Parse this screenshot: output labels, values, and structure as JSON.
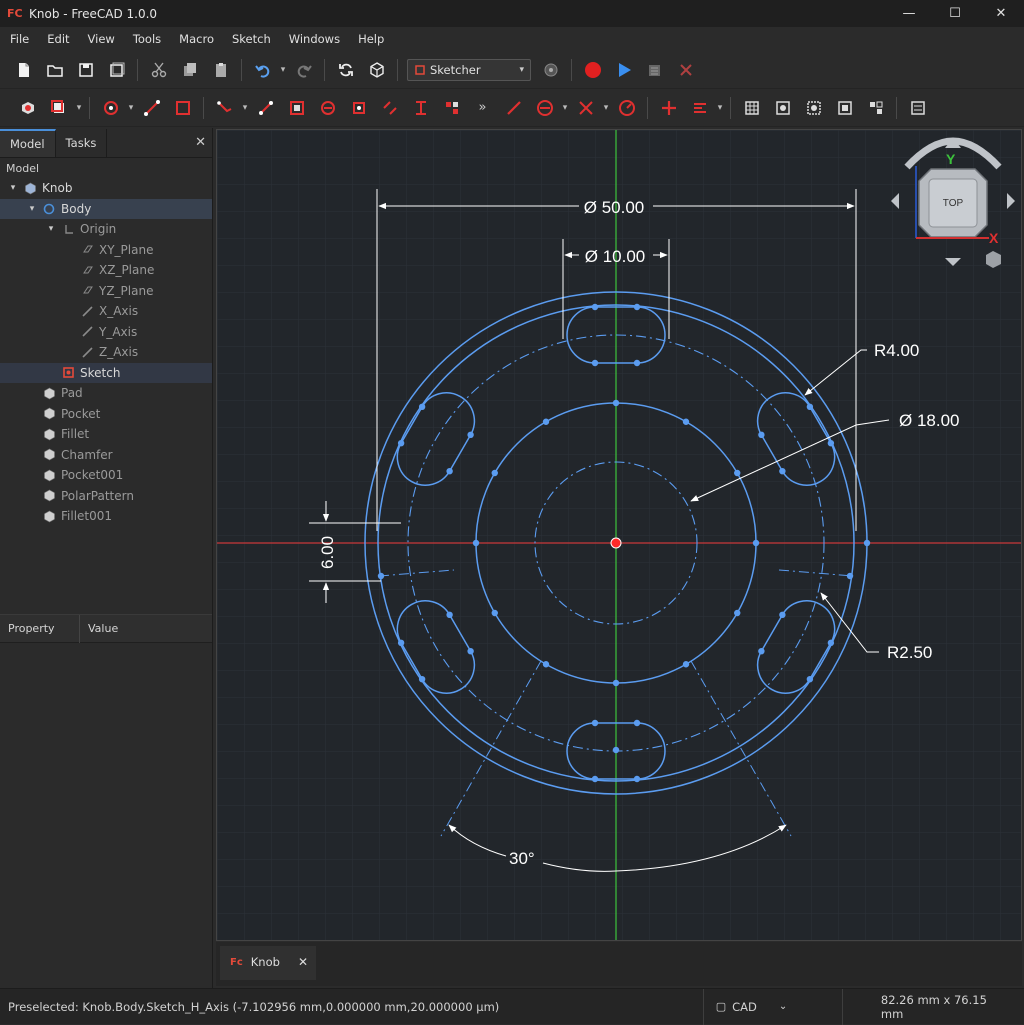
{
  "window": {
    "title": "Knob - FreeCAD 1.0.0",
    "logo": "FC",
    "minimize": "—",
    "maximize": "☐",
    "close": "✕"
  },
  "menu": [
    "File",
    "Edit",
    "View",
    "Tools",
    "Macro",
    "Sketch",
    "Windows",
    "Help"
  ],
  "workbench": {
    "selected": "Sketcher"
  },
  "left_tabs": {
    "model": "Model",
    "tasks": "Tasks",
    "close": "✕"
  },
  "tree": {
    "label": "Model",
    "items": [
      {
        "label": "Knob",
        "level": 0,
        "arrow": "▾",
        "icon": "document-icon"
      },
      {
        "label": "Body",
        "level": 1,
        "arrow": "▾",
        "icon": "body-icon",
        "state": "selected"
      },
      {
        "label": "Origin",
        "level": 2,
        "arrow": "▾",
        "icon": "origin-icon",
        "dim": true
      },
      {
        "label": "XY_Plane",
        "level": 3,
        "icon": "plane-icon",
        "dim": true
      },
      {
        "label": "XZ_Plane",
        "level": 3,
        "icon": "plane-icon",
        "dim": true
      },
      {
        "label": "YZ_Plane",
        "level": 3,
        "icon": "plane-icon",
        "dim": true
      },
      {
        "label": "X_Axis",
        "level": 3,
        "icon": "axis-icon",
        "dim": true
      },
      {
        "label": "Y_Axis",
        "level": 3,
        "icon": "axis-icon",
        "dim": true
      },
      {
        "label": "Z_Axis",
        "level": 3,
        "icon": "axis-icon",
        "dim": true
      },
      {
        "label": "Sketch",
        "level": 2,
        "icon": "sketch-icon",
        "state": "highlighted"
      },
      {
        "label": "Pad",
        "level": 1,
        "icon": "pad-icon",
        "dim": true
      },
      {
        "label": "Pocket",
        "level": 1,
        "icon": "pocket-icon",
        "dim": true
      },
      {
        "label": "Fillet",
        "level": 1,
        "icon": "fillet-icon",
        "dim": true
      },
      {
        "label": "Chamfer",
        "level": 1,
        "icon": "chamfer-icon",
        "dim": true
      },
      {
        "label": "Pocket001",
        "level": 1,
        "icon": "pocket-icon",
        "dim": true
      },
      {
        "label": "PolarPattern",
        "level": 1,
        "icon": "polar-pattern-icon",
        "dim": true
      },
      {
        "label": "Fillet001",
        "level": 1,
        "icon": "fillet-icon",
        "dim": true
      }
    ]
  },
  "property": {
    "col1": "Property",
    "col2": "Value"
  },
  "sketch": {
    "dim_outer": "Ø 50.00",
    "dim_slot": "Ø 10.00",
    "dim_r4": "R4.00",
    "dim_d18": "Ø 18.00",
    "dim_6": "6.00",
    "dim_r25": "R2.50",
    "dim_angle": "30°",
    "axis_colors": {
      "h": "#d23a3a",
      "v": "#3cc23c",
      "geometry": "#5b9cf0",
      "dimension": "#ffffff"
    }
  },
  "navcube": {
    "face": "TOP",
    "y_label": "Y",
    "x_label": "X"
  },
  "doc_tab": {
    "label": "Knob",
    "close": "✕"
  },
  "status": {
    "message": "Preselected: Knob.Body.Sketch_H_Axis (-7.102956 mm,0.000000 mm,20.000000 µm)",
    "nav_style": "CAD",
    "dimensions": "82.26 mm x 76.15 mm"
  }
}
